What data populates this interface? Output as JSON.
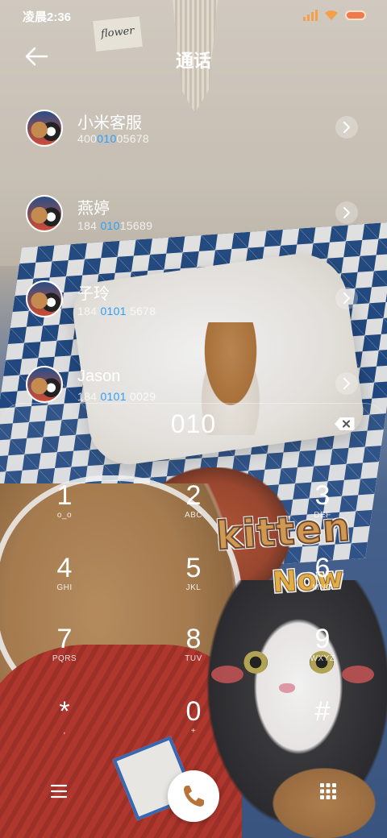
{
  "status_bar": {
    "time": "凌晨2:36"
  },
  "header": {
    "title": "通话"
  },
  "wallpaper": {
    "card_text": "flower",
    "sticker_line1": "kitten",
    "sticker_line2": "Now"
  },
  "contacts": [
    {
      "name": "小米客服",
      "num_pre": "400",
      "num_hl": "010",
      "num_post": "05678"
    },
    {
      "name": "燕婷",
      "num_pre": "184 ",
      "num_hl": "010",
      "num_post": "15689"
    },
    {
      "name": "子玲",
      "num_pre": "184 ",
      "num_hl": "0101",
      "num_post": " 5678"
    },
    {
      "name": "Jason",
      "num_pre": "184 ",
      "num_hl": "0101",
      "num_post": " 0029"
    }
  ],
  "dial": {
    "input": "010"
  },
  "keys": [
    {
      "digit": "1",
      "sub": "o_o"
    },
    {
      "digit": "2",
      "sub": "ABC"
    },
    {
      "digit": "3",
      "sub": "DEF"
    },
    {
      "digit": "4",
      "sub": "GHI"
    },
    {
      "digit": "5",
      "sub": "JKL"
    },
    {
      "digit": "6",
      "sub": "MNO"
    },
    {
      "digit": "7",
      "sub": "PQRS"
    },
    {
      "digit": "8",
      "sub": "TUV"
    },
    {
      "digit": "9",
      "sub": "WXYZ"
    },
    {
      "digit": "*",
      "sub": ","
    },
    {
      "digit": "0",
      "sub": "+"
    },
    {
      "digit": "#",
      "sub": ""
    }
  ],
  "icons": {
    "back": "arrow-left-icon",
    "backspace": "backspace-icon",
    "menu": "hamburger-menu-icon",
    "call": "phone-icon",
    "dialpad": "dialpad-grid-icon",
    "detail": "chevron-right-icon"
  },
  "colors": {
    "highlight": "#29a0ff",
    "accent_call": "#b8733a"
  }
}
